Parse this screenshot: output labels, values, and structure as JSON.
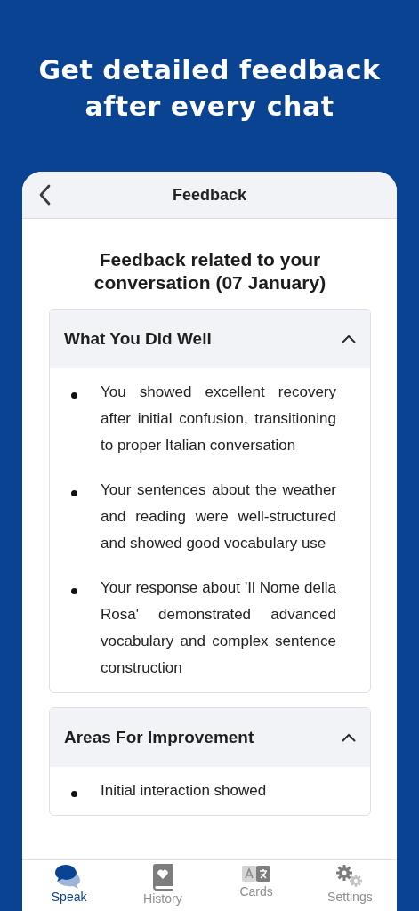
{
  "headline": "Get detailed feedback after every chat",
  "screen": {
    "title": "Feedback"
  },
  "heading": "Feedback related to your conversation (07 January)",
  "sections": [
    {
      "title": "What You Did Well",
      "expanded": true,
      "items": [
        "You showed excellent recovery after initial confusion, transitioning to proper Italian conversation",
        "Your sentences about the weather and reading were well-structured and showed good vocabulary use",
        "Your response about 'Il Nome della Rosa' demonstrated advanced vocabulary and complex sentence construction"
      ]
    },
    {
      "title": "Areas For Improvement",
      "expanded": true,
      "items": [
        "Initial interaction showed"
      ]
    }
  ],
  "tabs": [
    {
      "kind": "speak",
      "label": "Speak",
      "selected": true
    },
    {
      "kind": "history",
      "label": "History",
      "selected": false
    },
    {
      "kind": "cards",
      "label": "Cards",
      "selected": false
    },
    {
      "kind": "settings",
      "label": "Settings",
      "selected": false
    }
  ]
}
